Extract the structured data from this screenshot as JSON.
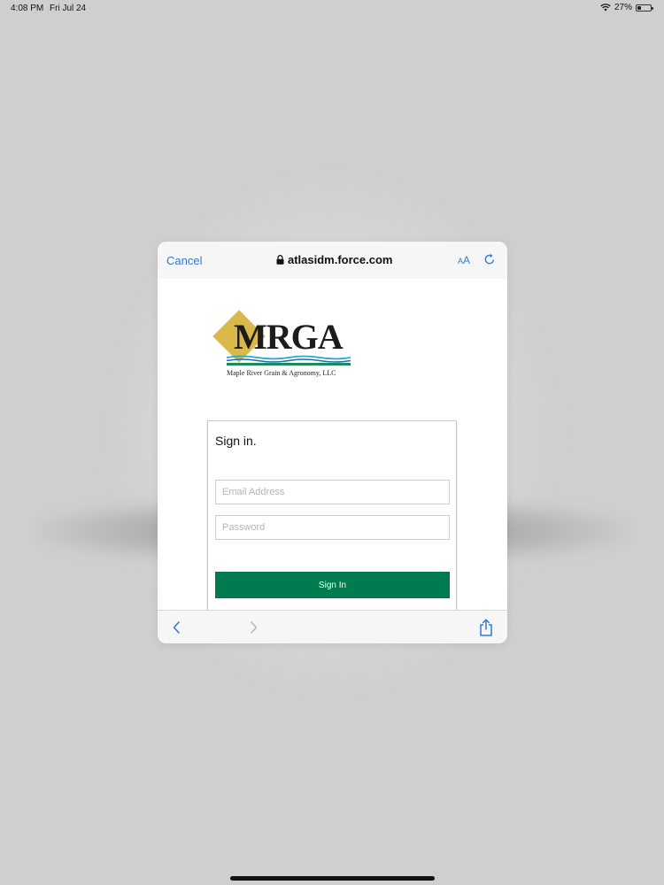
{
  "status_bar": {
    "time": "4:08 PM",
    "date": "Fri Jul 24",
    "battery": "27%",
    "battery_level": 0.27
  },
  "browser": {
    "cancel_label": "Cancel",
    "url": "atlasidm.force.com",
    "aa_label_small": "A",
    "aa_label_large": "A",
    "icons": {
      "lock": "lock-icon",
      "reload": "reload-icon",
      "back": "chevron-left-icon",
      "forward": "chevron-right-icon",
      "share": "share-icon"
    }
  },
  "logo": {
    "name": "MRGA",
    "tagline": "Maple River Grain & Agronomy, LLC"
  },
  "signin": {
    "heading": "Sign in.",
    "email_placeholder": "Email Address",
    "email_value": "",
    "password_placeholder": "Password",
    "password_value": "",
    "button_label": "Sign In"
  },
  "colors": {
    "accent": "#2f7bd6",
    "brand_green": "#007a4f",
    "logo_gold": "#d9b94a",
    "wave_blue": "#2aa7c8",
    "wave_green": "#1f8a55"
  }
}
